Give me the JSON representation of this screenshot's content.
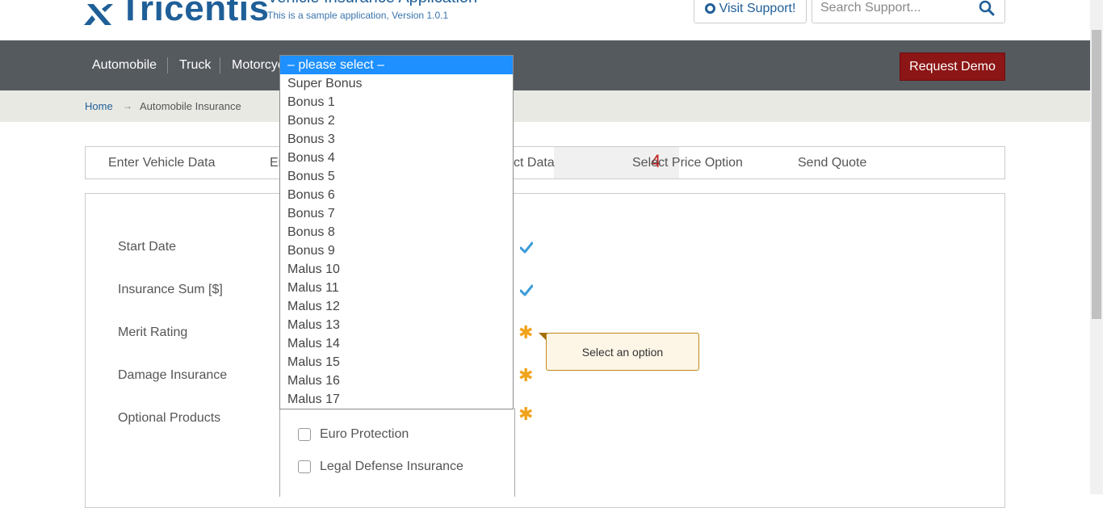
{
  "header": {
    "logo_text": "Tricentis",
    "app_title": "Vehicle Insurance Application",
    "app_subtitle": "This is a sample application, Version 1.0.1",
    "visit_support_label": "Visit Support!",
    "search_placeholder": "Search Support..."
  },
  "nav": {
    "items": [
      "Automobile",
      "Truck",
      "Motorcycle"
    ],
    "request_demo_label": "Request Demo"
  },
  "breadcrumb": {
    "home": "Home",
    "arrow": "→",
    "current": "Automobile Insurance"
  },
  "steps": {
    "items": [
      "Enter Vehicle Data",
      "Enter Insurant Data",
      "Enter Product Data",
      "Select Price Option",
      "Send Quote"
    ],
    "visible_fragments": [
      "Enter Vehicle Data",
      "En",
      "ct Data",
      "Select Price Option",
      "Send Quote"
    ],
    "active_number": "4"
  },
  "form": {
    "labels": [
      "Start Date",
      "Insurance Sum [$]",
      "Merit Rating",
      "Damage Insurance",
      "Optional Products"
    ],
    "status_icons": [
      "check-icon",
      "check-icon",
      "required-icon",
      "required-icon",
      "required-icon"
    ],
    "colors": {
      "check": "#3a9bd9",
      "required": "#f0a41c"
    }
  },
  "tooltip": {
    "text": "Select an option"
  },
  "optional_products": [
    "Euro Protection",
    "Legal Defense Insurance"
  ],
  "dropdown": {
    "selected": "– please select –",
    "options": [
      "– please select –",
      "Super Bonus",
      "Bonus 1",
      "Bonus 2",
      "Bonus 3",
      "Bonus 4",
      "Bonus 5",
      "Bonus 6",
      "Bonus 7",
      "Bonus 8",
      "Bonus 9",
      "Malus 10",
      "Malus 11",
      "Malus 12",
      "Malus 13",
      "Malus 14",
      "Malus 15",
      "Malus 16",
      "Malus 17"
    ]
  },
  "colors": {
    "brand": "#1f5f98",
    "nav_bg": "#555a5f",
    "demo_button": "#8c1515",
    "highlight": "#1e90ff",
    "step_number": "#c41e1e"
  }
}
